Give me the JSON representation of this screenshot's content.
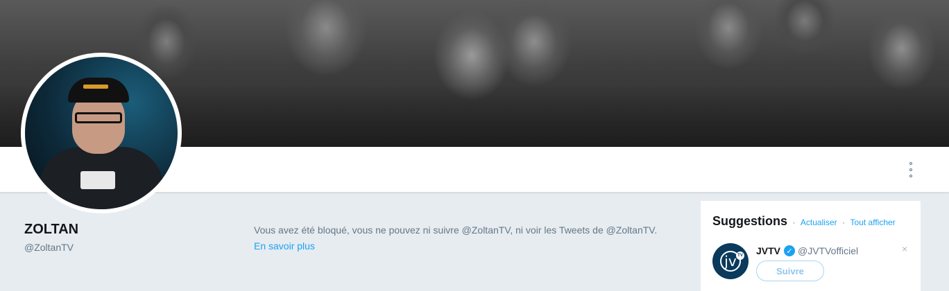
{
  "profile": {
    "name": "ZOLTAN",
    "handle": "@ZoltanTV"
  },
  "notice": {
    "blocked_text": "Vous avez été bloqué, vous ne pouvez ni suivre @ZoltanTV, ni voir les Tweets de @ZoltanTV.",
    "learn_more": "En savoir plus"
  },
  "suggestions": {
    "title": "Suggestions",
    "separator": "·",
    "refresh": "Actualiser",
    "view_all": "Tout afficher",
    "items": [
      {
        "name": "JVTV",
        "handle": "@JVTVofficiel",
        "avatar_text": "jv",
        "avatar_badge": "TV",
        "follow_label": "Suivre",
        "dismiss": "×",
        "verified_mark": "✓"
      }
    ]
  },
  "icons": {
    "more": "more-vertical-icon",
    "verified": "verified-badge-icon",
    "dismiss": "close-icon"
  },
  "colors": {
    "accent": "#1da1f2",
    "page_bg": "#e6ecf0",
    "text_primary": "#14171a",
    "text_secondary": "#657786"
  }
}
